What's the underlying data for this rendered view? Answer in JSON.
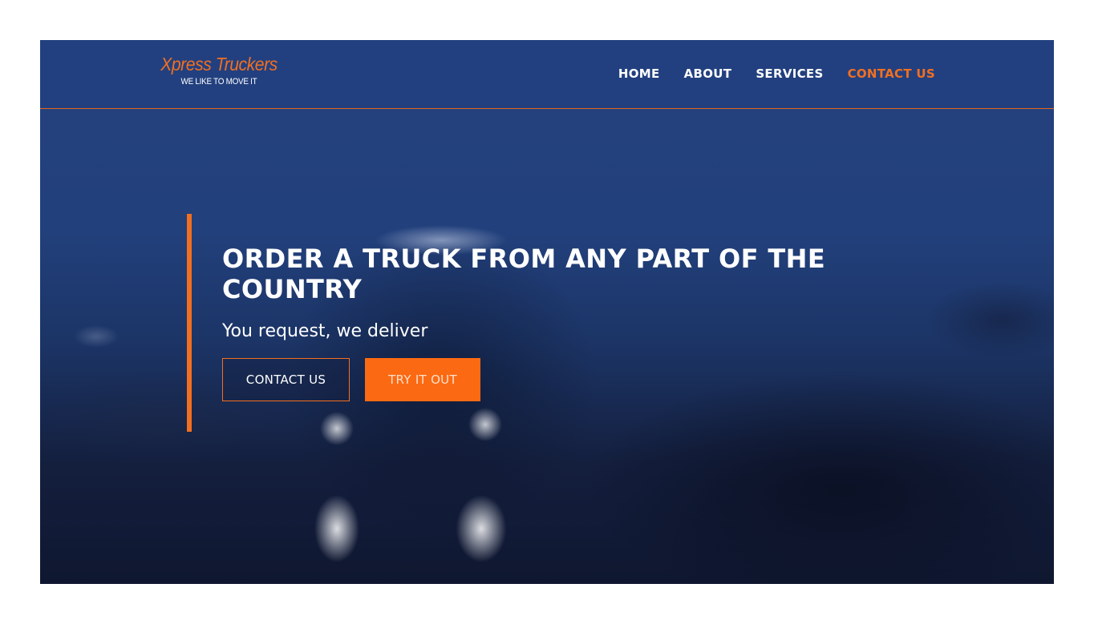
{
  "brand": {
    "name": "Xpress Truckers",
    "tagline": "WE LIKE TO MOVE IT",
    "accent_color": "#f26f20"
  },
  "nav": {
    "items": [
      {
        "label": "HOME",
        "active": false
      },
      {
        "label": "ABOUT",
        "active": false
      },
      {
        "label": "SERVICES",
        "active": false
      },
      {
        "label": "CONTACT US",
        "active": true
      }
    ]
  },
  "hero": {
    "title": "ORDER A TRUCK FROM ANY PART OF THE COUNTRY",
    "subtitle": "You request, we deliver",
    "primary_button": "CONTACT US",
    "secondary_button": "TRY IT OUT"
  }
}
